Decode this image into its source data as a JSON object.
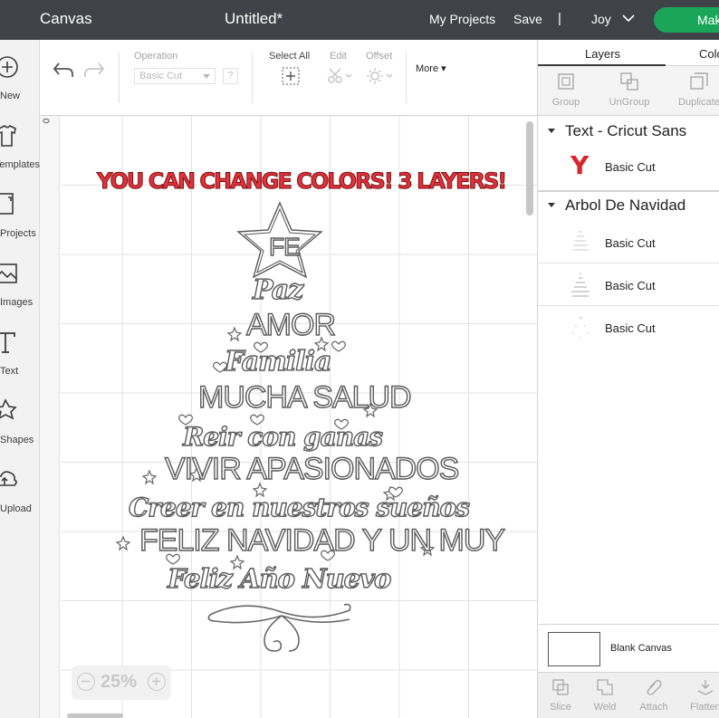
{
  "header": {
    "app_title": "Canvas",
    "doc_title": "Untitled*",
    "my_projects": "My Projects",
    "save": "Save",
    "separator": "|",
    "user": "Joy",
    "make_label": "Mak"
  },
  "left_rail": [
    {
      "label": "New",
      "icon": "plus-icon"
    },
    {
      "label": "Templates",
      "icon": "shirt-icon"
    },
    {
      "label": "Projects",
      "icon": "projects-icon"
    },
    {
      "label": "Images",
      "icon": "image-icon"
    },
    {
      "label": "Text",
      "icon": "text-icon"
    },
    {
      "label": "Shapes",
      "icon": "shapes-icon"
    },
    {
      "label": "Upload",
      "icon": "upload-icon"
    }
  ],
  "toolbar": {
    "operation_label": "Operation",
    "operation_value": "Basic Cut",
    "help": "?",
    "select_all": "Select All",
    "edit": "Edit",
    "offset": "Offset",
    "more": "More"
  },
  "canvas": {
    "ruler_zero": "0",
    "headline": "YOU CAN CHANGE COLORS! 3 LAYERS!",
    "tree_words": [
      "FE",
      "Paz",
      "AMOR",
      "Familia",
      "MUCHA SALUD",
      "Reir con ganas",
      "VIVIR APASIONADOS",
      "Creer en nuestros sueños",
      "FELIZ NAVIDAD Y UN MUY",
      "Feliz Año Nuevo"
    ],
    "zoom": "25%",
    "zoom_minus": "−",
    "zoom_plus": "+"
  },
  "panel": {
    "tabs": [
      "Layers",
      "Colo"
    ],
    "actions": [
      "Group",
      "UnGroup",
      "Duplicate"
    ],
    "groups": [
      {
        "title": "Text - Cricut Sans",
        "layers": [
          {
            "label": "Basic Cut",
            "thumb": "Y"
          }
        ]
      },
      {
        "title": "Arbol De Navidad",
        "layers": [
          {
            "label": "Basic Cut"
          },
          {
            "label": "Basic Cut"
          },
          {
            "label": "Basic Cut"
          }
        ]
      }
    ],
    "blank_canvas": "Blank Canvas",
    "bottom_actions": [
      "Slice",
      "Weld",
      "Attach",
      "Flatten"
    ]
  },
  "colors": {
    "header_bg": "#3f4246",
    "make_green": "#1aa659",
    "headline_red": "#e0323a",
    "text_layer_red": "#d9252e"
  }
}
